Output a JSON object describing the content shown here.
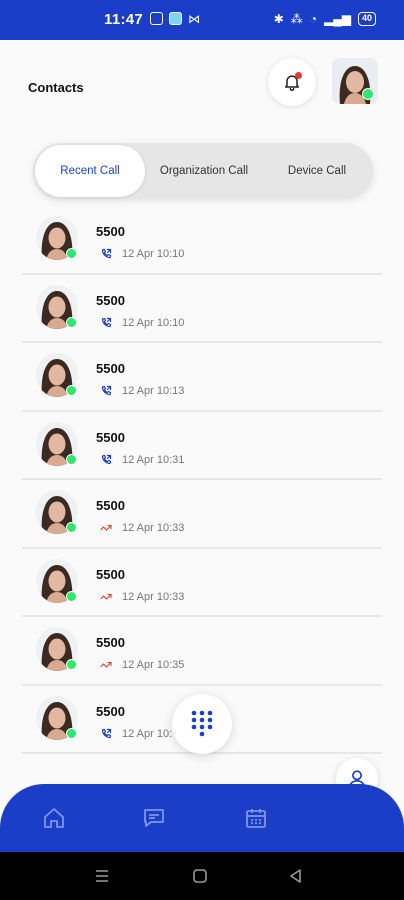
{
  "status_bar": {
    "time": "11:47",
    "battery": "40"
  },
  "header": {
    "title": "Contacts"
  },
  "tabs": [
    {
      "label": "Recent Call",
      "active": true
    },
    {
      "label": "Organization Call",
      "active": false
    },
    {
      "label": "Device Call",
      "active": false
    }
  ],
  "calls": [
    {
      "number": "5500",
      "time": "12 Apr 10:10",
      "type": "outgoing"
    },
    {
      "number": "5500",
      "time": "12 Apr 10:10",
      "type": "outgoing"
    },
    {
      "number": "5500",
      "time": "12 Apr 10:13",
      "type": "outgoing"
    },
    {
      "number": "5500",
      "time": "12 Apr 10:31",
      "type": "outgoing"
    },
    {
      "number": "5500",
      "time": "12 Apr 10:33",
      "type": "missed"
    },
    {
      "number": "5500",
      "time": "12 Apr 10:33",
      "type": "missed"
    },
    {
      "number": "5500",
      "time": "12 Apr 10:35",
      "type": "missed"
    },
    {
      "number": "5500",
      "time": "12 Apr 10:",
      "type": "outgoing"
    }
  ],
  "colors": {
    "brand": "#1a3ec8",
    "online": "#2ee86b",
    "missed": "#e53935"
  },
  "icons": {
    "bell": "bell-icon",
    "dialpad": "dialpad-icon",
    "contact": "person-icon",
    "nav": [
      "home-icon",
      "chat-icon",
      "calendar-icon"
    ]
  }
}
